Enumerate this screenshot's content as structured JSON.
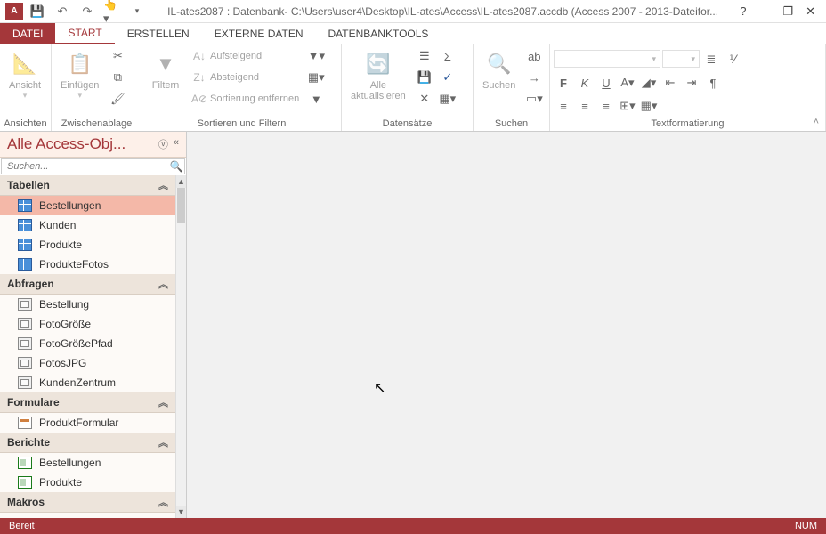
{
  "titlebar": {
    "title": "IL-ates2087 : Datenbank- C:\\Users\\user4\\Desktop\\IL-ates\\Access\\IL-ates2087.accdb (Access 2007 - 2013-Dateifor..."
  },
  "tabs": {
    "datei": "DATEI",
    "start": "START",
    "erstellen": "ERSTELLEN",
    "externe": "EXTERNE DATEN",
    "dbtools": "DATENBANKTOOLS"
  },
  "ribbon": {
    "ansichten": {
      "label": "Ansichten",
      "ansicht": "Ansicht"
    },
    "zwischenablage": {
      "label": "Zwischenablage",
      "einfuegen": "Einfügen"
    },
    "sortfilter": {
      "label": "Sortieren und Filtern",
      "filtern": "Filtern",
      "aufsteigend": "Aufsteigend",
      "absteigend": "Absteigend",
      "entfernen": "Sortierung entfernen"
    },
    "datensaetze": {
      "label": "Datensätze",
      "aktualisieren": "Alle\naktualisieren"
    },
    "suchen": {
      "label": "Suchen",
      "suchen": "Suchen"
    },
    "textfmt": {
      "label": "Textformatierung"
    }
  },
  "nav": {
    "title": "Alle Access-Obj...",
    "searchPlaceholder": "Suchen...",
    "cats": {
      "tabellen": "Tabellen",
      "abfragen": "Abfragen",
      "formulare": "Formulare",
      "berichte": "Berichte",
      "makros": "Makros"
    },
    "tables": [
      "Bestellungen",
      "Kunden",
      "Produkte",
      "ProdukteFotos"
    ],
    "queries": [
      "Bestellung",
      "FotoGröße",
      "FotoGrößePfad",
      "FotosJPG",
      "KundenZentrum"
    ],
    "forms": [
      "ProduktFormular"
    ],
    "reports": [
      "Bestellungen",
      "Produkte"
    ]
  },
  "status": {
    "left": "Bereit",
    "right": "NUM"
  }
}
